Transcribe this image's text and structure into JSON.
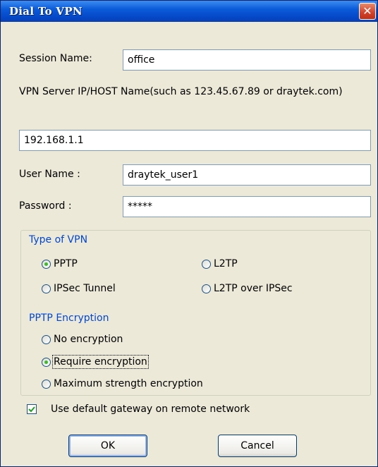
{
  "window": {
    "title": "Dial To VPN",
    "close_symbol": "✕"
  },
  "session": {
    "label": "Session Name:",
    "value": "office"
  },
  "server": {
    "label": "VPN Server IP/HOST Name(such as 123.45.67.89 or draytek.com)",
    "value": "192.168.1.1"
  },
  "user": {
    "label": "User Name :",
    "value": "draytek_user1"
  },
  "password": {
    "label": "Password :",
    "value": "*****"
  },
  "vpn_type": {
    "title": "Type of VPN",
    "options": [
      "PPTP",
      "L2TP",
      "IPSec Tunnel",
      "L2TP over IPSec"
    ],
    "selected": "PPTP"
  },
  "pptp_encryption": {
    "title": "PPTP Encryption",
    "options": [
      "No encryption",
      "Require encryption",
      "Maximum strength encryption"
    ],
    "selected": "Require encryption"
  },
  "gateway": {
    "label": "Use default gateway on remote network",
    "checked": true
  },
  "buttons": {
    "ok": "OK",
    "cancel": "Cancel"
  },
  "colors": {
    "title_bar": "#0b5bd9",
    "group_title": "#0046d5",
    "dialog_bg": "#ece9d8",
    "close_button": "#d0402a"
  }
}
